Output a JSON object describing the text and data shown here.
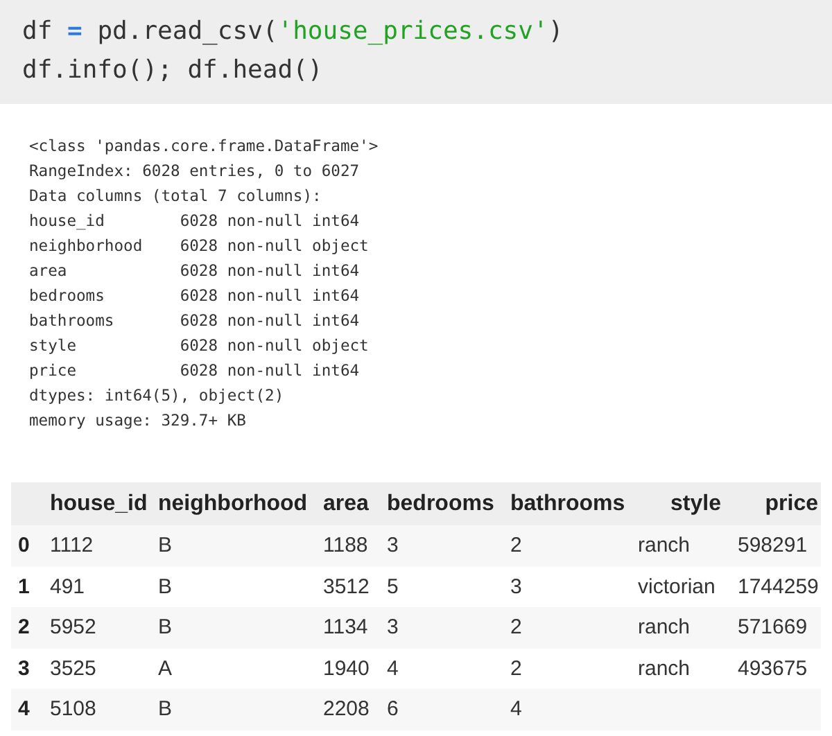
{
  "code_cell": {
    "lines": [
      [
        {
          "text": "df ",
          "kind": "plain"
        },
        {
          "text": "=",
          "kind": "operator"
        },
        {
          "text": " pd.read_csv(",
          "kind": "plain"
        },
        {
          "text": "'house_prices.csv'",
          "kind": "string"
        },
        {
          "text": ")",
          "kind": "plain"
        }
      ],
      [
        {
          "text": "df.info(); df.head()",
          "kind": "plain"
        }
      ]
    ]
  },
  "info_output": [
    "<class 'pandas.core.frame.DataFrame'>",
    "RangeIndex: 6028 entries, 0 to 6027",
    "Data columns (total 7 columns):",
    "house_id        6028 non-null int64",
    "neighborhood    6028 non-null object",
    "area            6028 non-null int64",
    "bedrooms        6028 non-null int64",
    "bathrooms       6028 non-null int64",
    "style           6028 non-null object",
    "price           6028 non-null int64",
    "dtypes: int64(5), object(2)",
    "memory usage: 329.7+ KB"
  ],
  "table": {
    "columns": [
      "house_id",
      "neighborhood",
      "area",
      "bedrooms",
      "bathrooms",
      "style",
      "price"
    ],
    "rows": [
      {
        "index": "0",
        "cells": [
          "1112",
          "B",
          "1188",
          "3",
          "2",
          "ranch",
          "598291"
        ]
      },
      {
        "index": "1",
        "cells": [
          "491",
          "B",
          "3512",
          "5",
          "3",
          "victorian",
          "1744259"
        ]
      },
      {
        "index": "2",
        "cells": [
          "5952",
          "B",
          "1134",
          "3",
          "2",
          "ranch",
          "571669"
        ]
      },
      {
        "index": "3",
        "cells": [
          "3525",
          "A",
          "1940",
          "4",
          "2",
          "ranch",
          "493675"
        ]
      },
      {
        "index": "4",
        "cells": [
          "5108",
          "B",
          "2208",
          "6",
          "4"
        ]
      }
    ]
  }
}
